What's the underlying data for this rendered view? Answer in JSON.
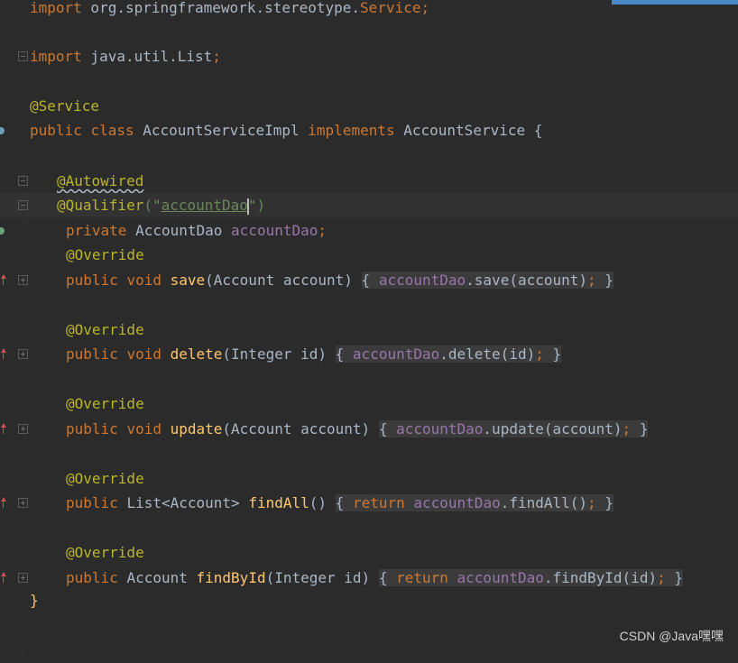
{
  "editor": {
    "lines": {
      "l0": {
        "kw": "import",
        "text": " org.springframework.stereotype.",
        "cls": "Service",
        "semi": ";"
      },
      "l1": {
        "kw": "import",
        "text": " java.util.List",
        "semi": ";"
      },
      "l2": {
        "ann": "@Service"
      },
      "l3": {
        "kw1": "public",
        "kw2": "class",
        "name": "AccountServiceImpl",
        "kw3": "implements",
        "iface": "AccountService",
        "brace": "{"
      },
      "l4": {
        "ann": "@Autowired"
      },
      "l5": {
        "ann": "@Qualifier",
        "open": "(\"",
        "str": "accountDao",
        "close": "\")"
      },
      "l6": {
        "kw": "private",
        "type": "AccountDao",
        "field": "accountDao",
        "semi": ";"
      },
      "l7": {
        "ann": "@Override"
      },
      "l8": {
        "kw1": "public",
        "kw2": "void",
        "method": "save",
        "params": "(Account account)",
        "open": "{",
        "field": "accountDao",
        "call": ".save(account)",
        "semi": ";",
        "close": "}"
      },
      "l9": {
        "ann": "@Override"
      },
      "l10": {
        "kw1": "public",
        "kw2": "void",
        "method": "delete",
        "params": "(Integer id)",
        "open": "{",
        "field": "accountDao",
        "call": ".delete(id)",
        "semi": ";",
        "close": "}"
      },
      "l11": {
        "ann": "@Override"
      },
      "l12": {
        "kw1": "public",
        "kw2": "void",
        "method": "update",
        "params": "(Account account)",
        "open": "{",
        "field": "accountDao",
        "call": ".update(account)",
        "semi": ";",
        "close": "}"
      },
      "l13": {
        "ann": "@Override"
      },
      "l14": {
        "kw1": "public",
        "type": "List<Account>",
        "method": "findAll",
        "params": "()",
        "open": "{",
        "ret": "return",
        "field": "accountDao",
        "call": ".findAll()",
        "semi": ";",
        "close": "}"
      },
      "l15": {
        "ann": "@Override"
      },
      "l16": {
        "kw1": "public",
        "type": "Account",
        "method": "findById",
        "params": "(Integer id)",
        "open": "{",
        "ret": "return",
        "field": "accountDao",
        "call": ".findById(id)",
        "semi": ";",
        "close": "}"
      },
      "l17": {
        "brace": "}"
      }
    }
  },
  "watermark": "CSDN @Java嘿嘿",
  "colors": {
    "background": "#2b2b2b",
    "keyword": "#cc7832",
    "plain": "#a9b7c6",
    "annotation": "#bbb529",
    "field": "#9876aa",
    "method": "#ffc66d",
    "string": "#6a8759"
  },
  "icons": [
    "fold-icon",
    "override-arrow-icon",
    "spring-bean-icon"
  ]
}
